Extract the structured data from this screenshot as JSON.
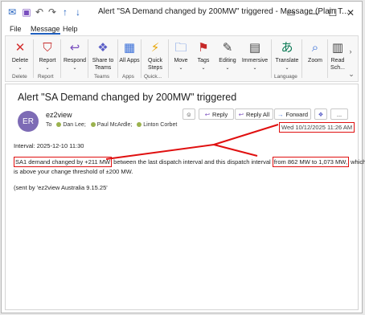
{
  "titlebar": {
    "title": "Alert \"SA Demand changed by 200MW\" triggered  -  Message (Plain T..."
  },
  "menu": [
    "File",
    "Message",
    "Help"
  ],
  "ribbon": {
    "buttons": [
      {
        "label": "Delete",
        "icon": "delete-x-icon"
      },
      {
        "label": "Report",
        "icon": "report-shield-icon"
      },
      {
        "label": "Respond",
        "icon": "respond-icon"
      },
      {
        "label": "Share to Teams",
        "icon": "teams-icon"
      },
      {
        "label": "All Apps",
        "icon": "apps-grid-icon"
      },
      {
        "label": "Quick Steps",
        "icon": "lightning-icon"
      },
      {
        "label": "Move",
        "icon": "move-icon"
      },
      {
        "label": "Tags",
        "icon": "tag-icon"
      },
      {
        "label": "Editing",
        "icon": "pencil-icon"
      },
      {
        "label": "Immersive",
        "icon": "immersive-icon"
      },
      {
        "label": "Translate",
        "icon": "translate-icon"
      },
      {
        "label": "Zoom",
        "icon": "zoom-icon"
      },
      {
        "label": "Read Sch...",
        "icon": "read-icon"
      }
    ],
    "groups": [
      "Delete",
      "Report",
      "Teams",
      "Apps",
      "Quick...",
      "Language"
    ]
  },
  "message": {
    "subject": "Alert \"SA Demand changed by 200MW\" triggered",
    "avatar_initials": "ER",
    "sender": "ez2view",
    "to_label": "To",
    "recipients": [
      "Dan Lee;",
      "Paul McArdle;",
      "Linton Corbet"
    ],
    "actions": {
      "react": "☺",
      "reply": "Reply",
      "reply_all": "Reply All",
      "forward": "Forward",
      "more": "..."
    },
    "date": "Wed 10/12/2025 11:26 AM",
    "interval": "Interval: 2025-12-10 11:30",
    "line1_a": "SA1 demand changed by +211 MW",
    "line1_b": " between the last dispatch interval and this dispatch interval ",
    "line1_c": "from 862 MW to 1,073 MW,",
    "line1_d": " which",
    "line2": "is above your change threshold of ±200 MW.",
    "sent_by": "(sent by 'ez2view Australia 9.15.25'"
  },
  "colors": {
    "accent": "#1f5fbf",
    "annotation": "#e01010",
    "avatar": "#7d6bb5"
  }
}
